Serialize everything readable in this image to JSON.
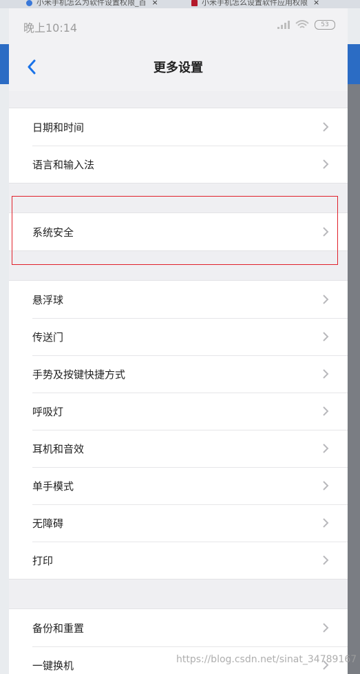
{
  "browser_tabs": [
    {
      "label": "小米手机怎么为软件设置权限_百",
      "close": "×"
    },
    {
      "label": "小米手机怎么设置软件应用权限",
      "close": "×"
    }
  ],
  "status_bar": {
    "time": "晚上10:14",
    "battery": "53"
  },
  "header": {
    "title": "更多设置"
  },
  "groups": [
    {
      "items": [
        "日期和时间",
        "语言和输入法"
      ]
    },
    {
      "items": [
        "系统安全"
      ]
    },
    {
      "items": [
        "悬浮球",
        "传送门",
        "手势及按键快捷方式",
        "呼吸灯",
        "耳机和音效",
        "单手模式",
        "无障碍",
        "打印"
      ]
    },
    {
      "items": [
        "备份和重置",
        "一键换机"
      ]
    }
  ],
  "watermark": "https://blog.csdn.net/sinat_34789167",
  "colors": {
    "accent": "#1a73e8",
    "highlight_border": "#e0202a"
  }
}
